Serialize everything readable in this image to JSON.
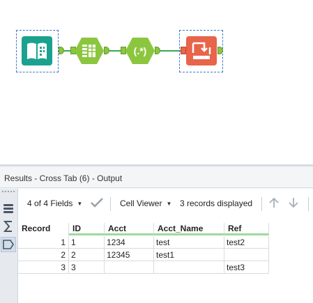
{
  "workflow": {
    "tools": [
      {
        "name": "Input Data",
        "icon": "input-data-icon",
        "color": "#1aa28f"
      },
      {
        "name": "Text To Columns",
        "icon": "text-to-columns-icon",
        "color": "#8cc63f"
      },
      {
        "name": "RegEx",
        "icon": "regex-icon",
        "color": "#8cc63f",
        "glyph": "(.*)"
      },
      {
        "name": "Cross Tab",
        "icon": "cross-tab-icon",
        "color": "#e8644a"
      }
    ],
    "connection_color": "#3aa657",
    "selection_color": "#3a78c2"
  },
  "results": {
    "title": "Results - Cross Tab (6) - Output",
    "toolbar": {
      "fields_label": "4 of 4 Fields",
      "viewer_label": "Cell Viewer",
      "records_label": "3 records displayed"
    },
    "grid": {
      "columns": [
        "Record",
        "ID",
        "Acct",
        "Acct_Name",
        "Ref"
      ],
      "rows": [
        [
          "1",
          "1",
          "1234",
          "test",
          "test2"
        ],
        [
          "2",
          "2",
          "12345",
          "test1",
          ""
        ],
        [
          "3",
          "3",
          "",
          "",
          "test3"
        ]
      ]
    }
  }
}
